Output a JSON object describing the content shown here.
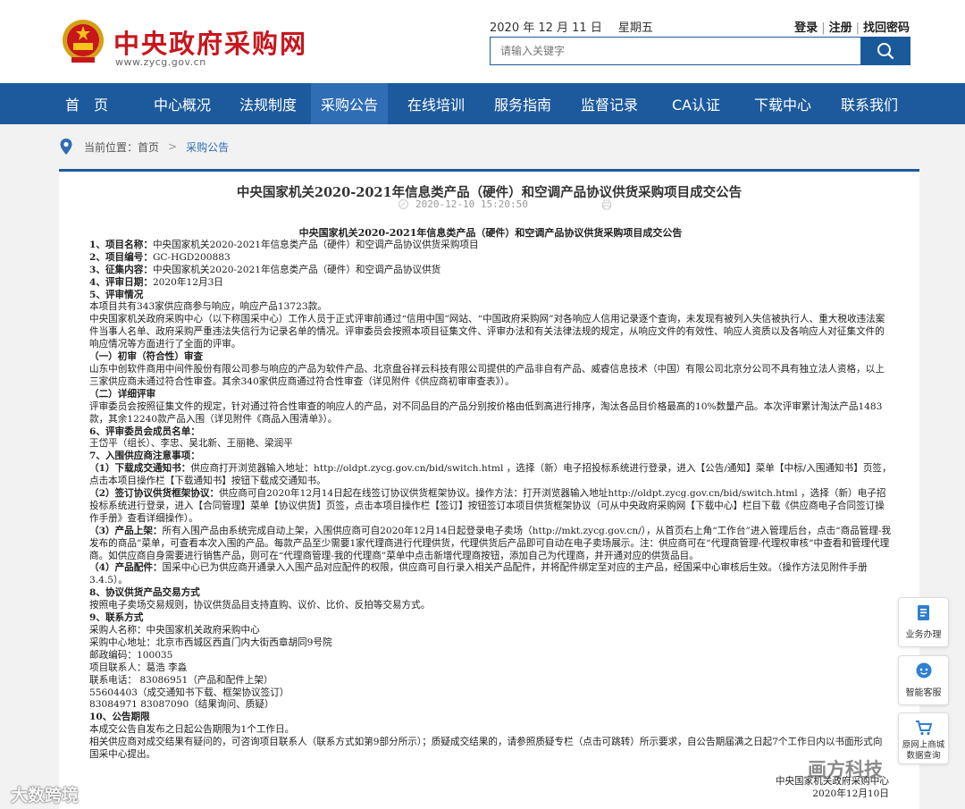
{
  "header": {
    "site_title": "中央政府采购网",
    "site_url": "www.zycg.gov.cn",
    "date": "2020 年 12 月 11 日",
    "weekday": "星期五",
    "login": "登录",
    "register": "注册",
    "recover": "找回密码",
    "search_placeholder": "请输入关键字"
  },
  "nav": {
    "items": [
      {
        "label": "首　页"
      },
      {
        "label": "中心概况"
      },
      {
        "label": "法规制度"
      },
      {
        "label": "采购公告"
      },
      {
        "label": "在线培训"
      },
      {
        "label": "服务指南"
      },
      {
        "label": "监督记录"
      },
      {
        "label": "CA认证"
      },
      {
        "label": "下载中心"
      },
      {
        "label": "联系我们"
      }
    ],
    "active_index": 3
  },
  "breadcrumb": {
    "prefix": "当前位置：",
    "home": "首页",
    "current": "采购公告"
  },
  "article": {
    "title": "中央国家机关2020-2021年信息类产品（硬件）和空调产品协议供货采购项目成交公告",
    "date": "2020-12-10 15:20:50",
    "content_title": "中央国家机关2020-2021年信息类产品（硬件）和空调产品协议供货采购项目成交公告",
    "lines": [
      "<b>1、项目名称：</b>中央国家机关2020-2021年信息类产品（硬件）和空调产品协议供货采购项目",
      "<b>2、项目编号：</b>GC-HGD200883",
      "<b>3、征集内容：</b>中央国家机关2020-2021年信息类产品（硬件）和空调产品协议供货",
      "<b>4、评审日期：</b>2020年12月3日",
      "<b>5、评审情况</b>",
      "本项目共有343家供应商参与响应，响应产品13723款。",
      "中央国家机关政府采购中心（以下称国采中心）工作人员于正式评审前通过“信用中国”网站、“中国政府采购网”对各响应人信用记录逐个查询，未发现有被列入失信被执行人、重大税收违法案件当事人名单、政府采购严重违法失信行为记录名单的情况。评审委员会按照本项目征集文件、评审办法和有关法律法规的规定，从响应文件的有效性、响应人资质以及各响应人对征集文件的响应情况等方面进行了全面的评审。",
      "<b>（一）初审（符合性）审查</b>",
      "山东中创软件商用中间件股份有限公司参与响应的产品为软件产品、北京盘谷祥云科技有限公司提供的产品非自有产品、威睿信息技术（中国）有限公司北京分公司不具有独立法人资格，以上三家供应商未通过符合性审查。其余340家供应商通过符合性审查（详见附件《供应商初审审查表》）。",
      "<b>（二）详细评审</b>",
      "评审委员会按照征集文件的规定，针对通过符合性审查的响应人的产品，对不同品目的产品分别按价格由低到高进行排序，淘汰各品目价格最高的10%数量产品。本次评审累计淘汰产品1483款，其余12240款产品入围（详见附件《商品入围清单》）。",
      "<b>6、评审委员会成员名单：</b>",
      "王岱平（组长）、李忠、吴北新、王丽艳、梁润平",
      "<b>7、入围供应商注意事项：</b>",
      "<b>（1）下载成交通知书：</b>供应商打开浏览器输入地址：http://oldpt.zycg.gov.cn/bid/switch.html ，选择（新）电子招投标系统进行登录，进入【公告/通知】菜单【中标/入围通知书】页签，点击本项目操作栏【下载通知书】按钮下载成交通知书。",
      "<b>（2）签订协议供货框架协议：</b>供应商可自2020年12月14日起在线签订协议供货框架协议。操作方法：打开浏览器输入地址http://oldpt.zycg.gov.cn/bid/switch.html ，选择（新）电子招投标系统进行登录，进入【合同管理】菜单【协议供货】页签，点击本项目操作栏【签订】按钮签订本项目供货框架协议（可从中央政府采购网【下载中心】栏目下载《供应商电子合同签订操作手册》查看详细操作）。",
      "<b>（3）产品上架：</b>所有入围产品由系统完成自动上架，入围供应商可自2020年12月14日起登录电子卖场（http://mkt.zycg.gov.cn/），从首页右上角“工作台”进入管理后台，点击“商品管理-我发布的商品”菜单，可查看本次入围的产品。每款产品至少需要1家代理商进行代理供货，代理供货后产品即可自动在电子卖场展示。注：供应商可在“代理商管理-代理权审核”中查看和管理代理商。如供应商自身需要进行销售产品，则可在“代理商管理-我的代理商”菜单中点击新增代理商按钮，添加自己为代理商，并开通对应的供货品目。",
      "<b>（4）产品配件：</b>国采中心已为供应商开通录入入围产品对应配件的权限，供应商可自行录入相关产品配件，并将配件绑定至对应的主产品，经国采中心审核后生效。（操作方法见附件手册3.4.5）。",
      "<b>8、协议供货产品交易方式</b>",
      "按照电子卖场交易规则，协议供货品目支持直购、议价、比价、反拍等交易方式。",
      "<b>9、联系方式</b>",
      "采购人名称：中央国家机关政府采购中心",
      "采购中心地址：北京市西城区西直门内大街西章胡同9号院",
      "邮政编码：100035",
      "项目联系人：葛浩 李淼",
      "联系电话： 83086951（产品和配件上架）",
      "55604403（成交通知书下载、框架协议签订）",
      "83084971 83087090（结果询问、质疑）",
      "<b>10、公告期限</b>",
      "本成交公告自发布之日起公告期限为1个工作日。",
      "相关供应商对成交结果有疑问的，可咨询项目联系人（联系方式如第9部分所示）；质疑成交结果的，请参照质疑专栏（点击可跳转）所示要求，自公告期届满之日起7个工作日内以书面形式向国采中心提出。"
    ],
    "sign_org": "中央国家机关政府采购中心",
    "sign_date": "2020年12月10日"
  },
  "side": {
    "business": "业务办理",
    "service": "智能客服",
    "mall": "原网上商城数据查询"
  },
  "watermarks": {
    "left": "大数跨境",
    "right": "画方科技"
  }
}
